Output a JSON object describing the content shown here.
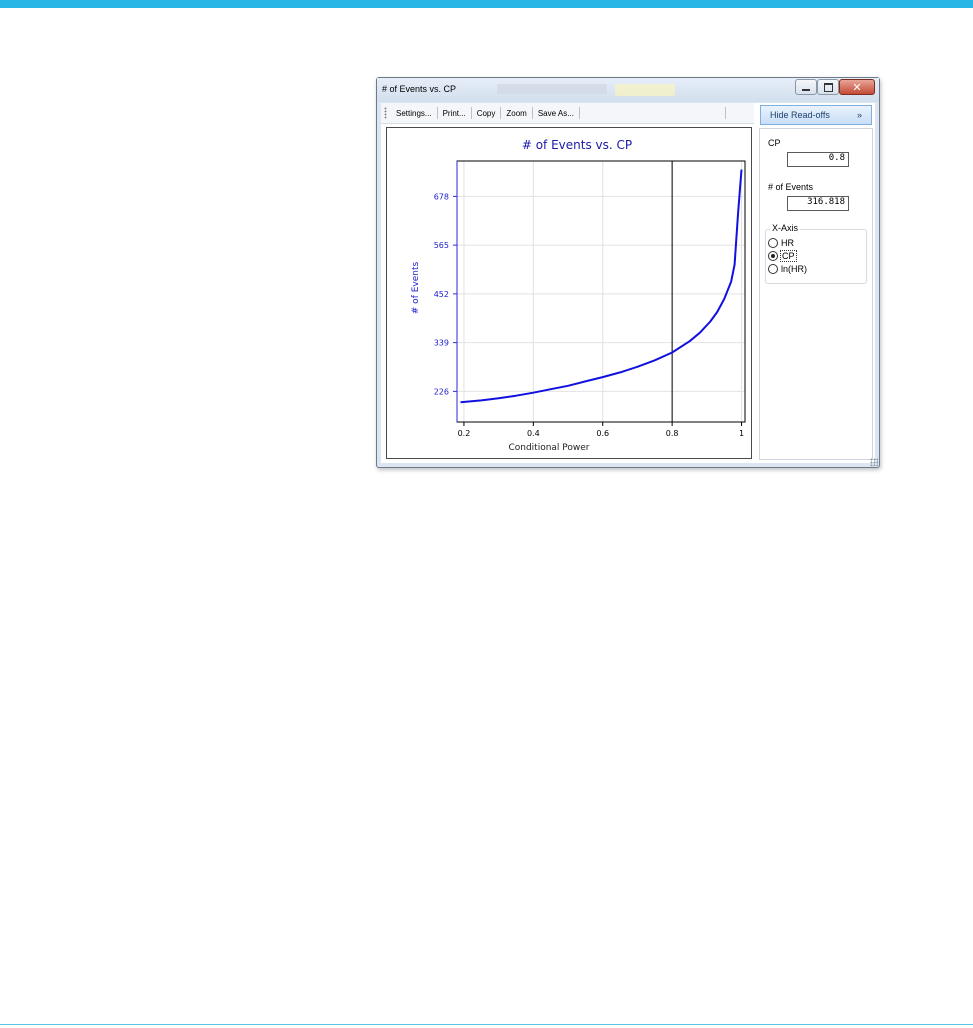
{
  "window": {
    "title": "# of Events vs. CP"
  },
  "toolbar": {
    "buttons": [
      "Settings...",
      "Print...",
      "Copy",
      "Zoom",
      "Save As..."
    ]
  },
  "sidepanel": {
    "hide_label": "Hide Read-offs",
    "hide_chevron": "»",
    "cp_label": "CP",
    "cp_value": "0.8",
    "events_label": "# of Events",
    "events_value": "316.818",
    "xaxis_title": "X-Axis",
    "xaxis_options": [
      {
        "label": "HR",
        "checked": false
      },
      {
        "label": "CP",
        "checked": true
      },
      {
        "label": "ln(HR)",
        "checked": false
      }
    ]
  },
  "chart_data": {
    "type": "line",
    "title": "# of Events vs. CP",
    "xlabel": "Conditional Power",
    "ylabel": "# of Events",
    "xlim": [
      0.18,
      1.01
    ],
    "ylim": [
      155,
      760
    ],
    "x_ticks": [
      0.2,
      0.4,
      0.6,
      0.8,
      1
    ],
    "x_tick_labels": [
      "0.2",
      "0.4",
      "0.6",
      "0.8",
      "1"
    ],
    "y_ticks": [
      226,
      339,
      452,
      565,
      678
    ],
    "y_tick_labels": [
      "226",
      "339",
      "452",
      "565",
      "678"
    ],
    "grid": true,
    "readoff_x": 0.8,
    "series": [
      {
        "color": "#1010e0",
        "x": [
          0.19,
          0.25,
          0.3,
          0.35,
          0.4,
          0.45,
          0.5,
          0.55,
          0.6,
          0.65,
          0.7,
          0.75,
          0.8,
          0.85,
          0.88,
          0.91,
          0.93,
          0.95,
          0.97,
          0.98,
          0.99,
          1.0
        ],
        "y": [
          201,
          205,
          210,
          216,
          223,
          231,
          239,
          249,
          259,
          270,
          283,
          298,
          316,
          342,
          362,
          388,
          410,
          440,
          480,
          520,
          640,
          740
        ]
      }
    ]
  }
}
